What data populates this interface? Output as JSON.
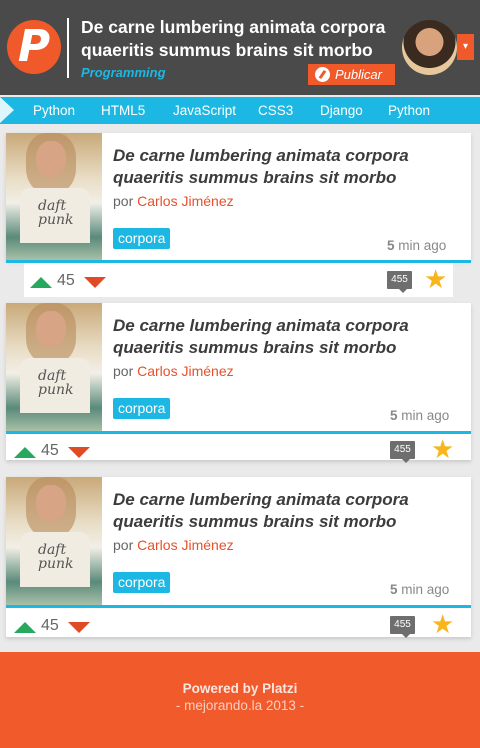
{
  "header": {
    "title": "De carne lumbering animata corpora quaeritis summus brains sit morbo",
    "category": "Programming",
    "publish_label": "Publicar",
    "logo_letter": "P",
    "dropdown_arrow": "▾"
  },
  "nav": {
    "items": [
      "Python",
      "HTML5",
      "JavaScript",
      "CSS3",
      "Django",
      "Python"
    ]
  },
  "posts": [
    {
      "title": "De carne lumbering animata corpora quaeritis summus brains sit morbo",
      "by": "por",
      "author": "Carlos Jiménez",
      "tag": "corpora",
      "time_num": "5",
      "time_unit": "min ago",
      "votes": "45",
      "comments": "455",
      "thumb_text": "daft punk"
    },
    {
      "title": "De carne lumbering animata corpora quaeritis summus brains sit morbo",
      "by": "por",
      "author": "Carlos Jiménez",
      "tag": "corpora",
      "time_num": "5",
      "time_unit": "min ago",
      "votes": "45",
      "comments": "455",
      "thumb_text": "daft punk"
    },
    {
      "title": "De carne lumbering animata corpora quaeritis summus brains sit morbo",
      "by": "por",
      "author": "Carlos Jiménez",
      "tag": "corpora",
      "time_num": "5",
      "time_unit": "min ago",
      "votes": "45",
      "comments": "455",
      "thumb_text": "daft punk"
    }
  ],
  "footer": {
    "line1": "Powered by Platzi",
    "line2": "- mejorando.la 2013 -"
  },
  "colors": {
    "header_bg": "#4a4a4a",
    "accent_orange": "#f05a2b",
    "accent_blue": "#1cb8e3",
    "upvote": "#28a85e",
    "downvote": "#e04a24",
    "star": "#f8b51c"
  },
  "icons": [
    "logo-icon",
    "pencil-icon",
    "chevron-down-icon",
    "upvote-icon",
    "downvote-icon",
    "comment-icon",
    "star-icon"
  ]
}
